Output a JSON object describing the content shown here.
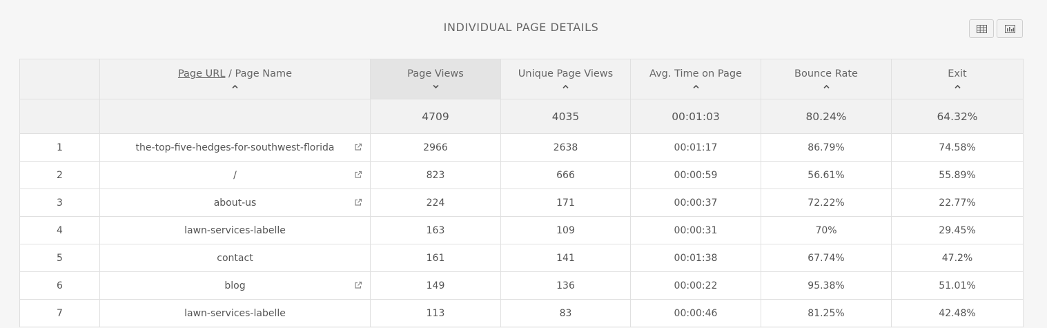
{
  "title": "INDIVIDUAL  PAGE  DETAILS",
  "toolbar": {
    "table_icon": "table-icon",
    "chart_icon": "bar-chart-icon"
  },
  "table": {
    "headers": {
      "index": "",
      "page_url": "Page URL",
      "separator": " / ",
      "page_name": "Page Name",
      "page_views": "Page Views",
      "unique_page_views": "Unique Page Views",
      "avg_time": "Avg. Time on Page",
      "bounce_rate": "Bounce Rate",
      "exit": "Exit"
    },
    "sorted_column": "page_views",
    "totals": {
      "page_views": "4709",
      "unique_page_views": "4035",
      "avg_time": "00:01:03",
      "bounce_rate": "80.24%",
      "exit": "64.32%"
    },
    "rows": [
      {
        "index": "1",
        "page": "the-top-five-hedges-for-southwest-florida",
        "external_link": true,
        "page_views": "2966",
        "unique_page_views": "2638",
        "avg_time": "00:01:17",
        "bounce_rate": "86.79%",
        "exit": "74.58%"
      },
      {
        "index": "2",
        "page": "/",
        "external_link": true,
        "page_views": "823",
        "unique_page_views": "666",
        "avg_time": "00:00:59",
        "bounce_rate": "56.61%",
        "exit": "55.89%"
      },
      {
        "index": "3",
        "page": "about-us",
        "external_link": true,
        "page_views": "224",
        "unique_page_views": "171",
        "avg_time": "00:00:37",
        "bounce_rate": "72.22%",
        "exit": "22.77%"
      },
      {
        "index": "4",
        "page": "lawn-services-labelle",
        "external_link": false,
        "page_views": "163",
        "unique_page_views": "109",
        "avg_time": "00:00:31",
        "bounce_rate": "70%",
        "exit": "29.45%"
      },
      {
        "index": "5",
        "page": "contact",
        "external_link": false,
        "page_views": "161",
        "unique_page_views": "141",
        "avg_time": "00:01:38",
        "bounce_rate": "67.74%",
        "exit": "47.2%"
      },
      {
        "index": "6",
        "page": "blog",
        "external_link": true,
        "page_views": "149",
        "unique_page_views": "136",
        "avg_time": "00:00:22",
        "bounce_rate": "95.38%",
        "exit": "51.01%"
      },
      {
        "index": "7",
        "page": "lawn-services-labelle",
        "external_link": false,
        "page_views": "113",
        "unique_page_views": "83",
        "avg_time": "00:00:46",
        "bounce_rate": "81.25%",
        "exit": "42.48%"
      }
    ]
  }
}
